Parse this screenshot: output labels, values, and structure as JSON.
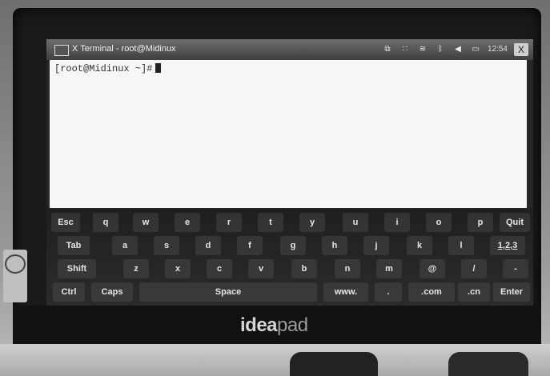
{
  "window": {
    "title": "X Terminal - root@Midinux",
    "title_icon": "terminal-icon",
    "tray": {
      "icons": [
        "window-switch-icon",
        "apps-grid-icon",
        "wifi-icon",
        "bluetooth-icon",
        "volume-icon",
        "battery-icon"
      ],
      "clock": "12:54",
      "close_label": "X"
    }
  },
  "terminal": {
    "prompt": "[root@Midinux ~]#"
  },
  "keyboard": {
    "row1": [
      "Esc",
      "q",
      "w",
      "e",
      "r",
      "t",
      "y",
      "u",
      "i",
      "o",
      "p",
      "Quit"
    ],
    "row2": [
      "Tab",
      "a",
      "s",
      "d",
      "f",
      "g",
      "h",
      "j",
      "k",
      "l",
      "1,2,3"
    ],
    "row3": [
      "Shift",
      "z",
      "x",
      "c",
      "v",
      "b",
      "n",
      "m",
      "@",
      "/",
      "-"
    ],
    "row4": [
      "Ctrl",
      "Caps",
      "Space",
      "www.",
      ".",
      ".com",
      ".cn",
      "Enter"
    ]
  },
  "device": {
    "brand_bold": "idea",
    "brand_light": "pad"
  }
}
